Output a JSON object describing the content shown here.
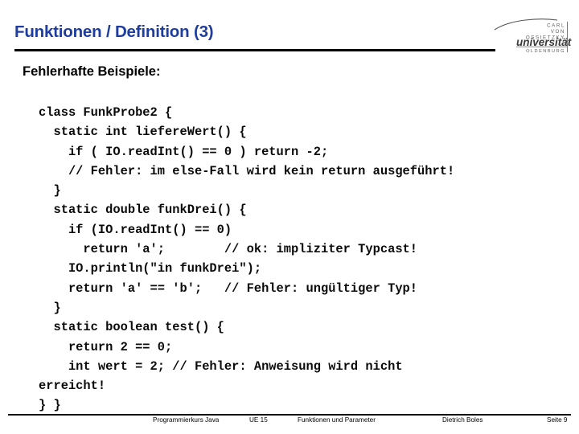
{
  "header": {
    "title": "Funktionen / Definition (3)",
    "title_color": "#1F3D9E",
    "rule_color": "#000000"
  },
  "logo": {
    "line1": "CARL",
    "line2": "VON",
    "line3": "OSSIETZKY",
    "wordmark": "universität",
    "city": "OLDENBURG",
    "alt": "Carl von Ossietzky Universität Oldenburg"
  },
  "content": {
    "subtitle": "Fehlerhafte Beispiele:",
    "code_lines": [
      "class FunkProbe2 {",
      "  static int liefereWert() {",
      "    if ( IO.readInt() == 0 ) return -2;",
      "    // Fehler: im else-Fall wird kein return ausgeführt!",
      "  }",
      "  static double funkDrei() {",
      "    if (IO.readInt() == 0)",
      "      return 'a';        // ok: impliziter Typcast!",
      "    IO.println(\"in funkDrei\");",
      "    return 'a' == 'b';   // Fehler: ungültiger Typ!",
      "  }",
      "  static boolean test() {",
      "    return 2 == 0;",
      "    int wert = 2; // Fehler: Anweisung wird nicht",
      "erreicht!",
      "} }"
    ]
  },
  "footer": {
    "course": "Programmierkurs Java",
    "unit": "UE 15",
    "topic": "Funktionen und Parameter",
    "author": "Dietrich Boles",
    "page": "Seite 9"
  }
}
